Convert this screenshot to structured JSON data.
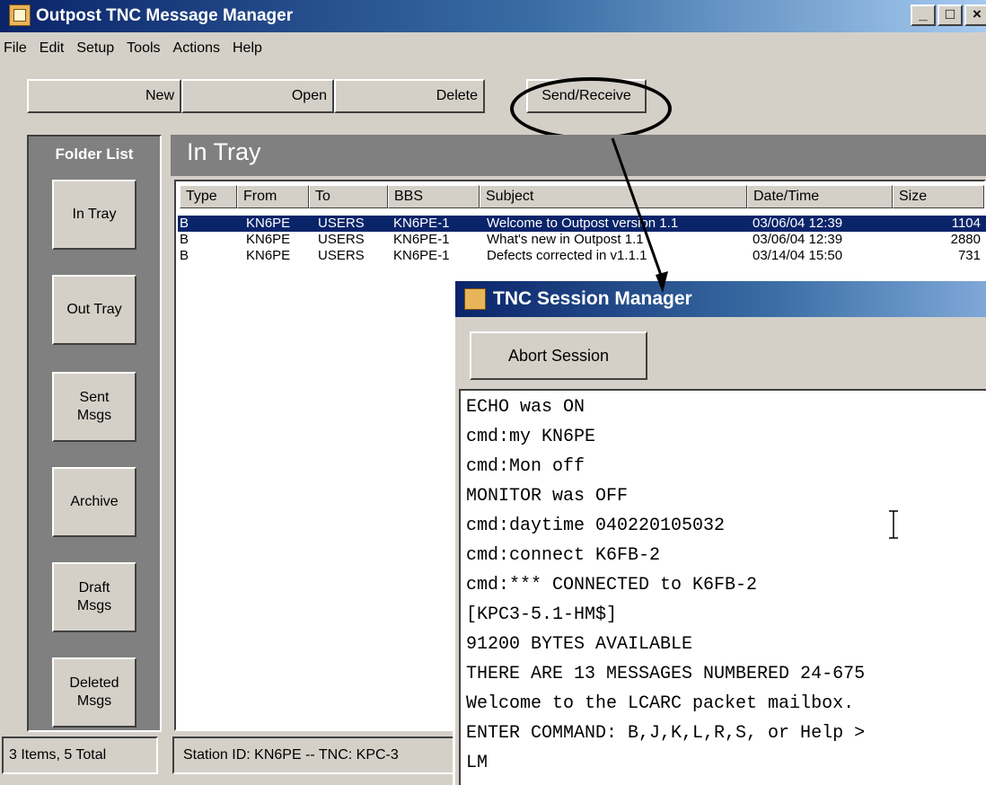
{
  "window": {
    "title": "Outpost TNC Message Manager",
    "minimize": "_",
    "maximize": "□",
    "close": "×"
  },
  "menu": [
    "File",
    "Edit",
    "Setup",
    "Tools",
    "Actions",
    "Help"
  ],
  "toolbar": {
    "new": "New",
    "open": "Open",
    "delete": "Delete",
    "send_receive": "Send/Receive"
  },
  "folders": {
    "title": "Folder List",
    "items": [
      {
        "line1": "In Tray",
        "line2": ""
      },
      {
        "line1": "Out Tray",
        "line2": ""
      },
      {
        "line1": "Sent",
        "line2": "Msgs"
      },
      {
        "line1": "Archive",
        "line2": ""
      },
      {
        "line1": "Draft",
        "line2": "Msgs"
      },
      {
        "line1": "Deleted",
        "line2": "Msgs"
      }
    ]
  },
  "tray": {
    "title": "In Tray",
    "columns": [
      "Type",
      "From",
      "To",
      "BBS",
      "Subject",
      "Date/Time",
      "Size"
    ],
    "rows": [
      {
        "type": "B",
        "from": "KN6PE",
        "to": "USERS",
        "bbs": "KN6PE-1",
        "subject": "Welcome to Outpost version 1.1",
        "datetime": "03/06/04 12:39",
        "size": "1104",
        "selected": true
      },
      {
        "type": "B",
        "from": "KN6PE",
        "to": "USERS",
        "bbs": "KN6PE-1",
        "subject": "What's new in Outpost 1.1",
        "datetime": "03/06/04 12:39",
        "size": "2880",
        "selected": false
      },
      {
        "type": "B",
        "from": "KN6PE",
        "to": "USERS",
        "bbs": "KN6PE-1",
        "subject": "Defects corrected in v1.1.1",
        "datetime": "03/14/04 15:50",
        "size": "731",
        "selected": false
      }
    ]
  },
  "status": {
    "items": "3 Items, 5 Total",
    "station": "Station ID: KN6PE  --  TNC: KPC-3"
  },
  "tnc": {
    "title": "TNC Session Manager",
    "abort": "Abort Session",
    "log": [
      "ECHO was ON",
      "cmd:my KN6PE",
      "cmd:Mon off",
      "MONITOR was OFF",
      "cmd:daytime 040220105032",
      "cmd:connect K6FB-2",
      "cmd:*** CONNECTED to K6FB-2",
      "[KPC3-5.1-HM$]",
      "91200 BYTES AVAILABLE",
      "THERE ARE 13 MESSAGES NUMBERED 24-675",
      "Welcome to the LCARC packet mailbox.",
      "ENTER COMMAND:  B,J,K,L,R,S, or Help >",
      "LM"
    ]
  },
  "colors": {
    "titlebar": "#0a246a",
    "face": "#d4d0c8",
    "panel": "#808080",
    "selection": "#0a246a"
  }
}
